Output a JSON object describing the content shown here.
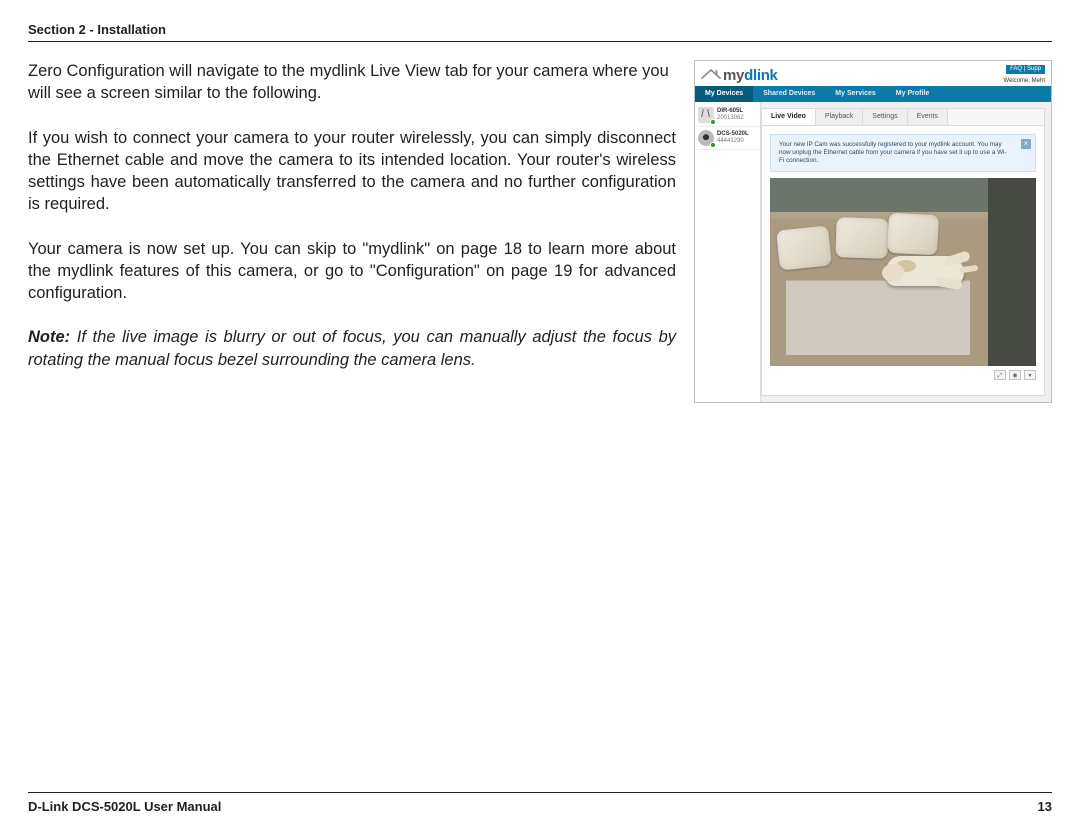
{
  "header": {
    "section_title": "Section 2 - Installation"
  },
  "body": {
    "p1": "Zero Configuration will navigate to the mydlink Live View tab for your camera where you will see a screen similar to the following.",
    "p2": "If you wish to connect your camera to your router wirelessly, you can simply disconnect the Ethernet cable and move the camera to its intended location. Your router's wireless settings have been automatically transferred to the camera and no further configuration is required.",
    "p3": "Your camera is now set up. You can skip to \"mydlink\" on page 18 to learn more about the mydlink features of this camera, or go to \"Configuration\" on page 19 for advanced configuration.",
    "note_label": "Note:",
    "note_text": " If the live image is blurry or out of focus, you can manually adjust the focus by rotating the manual focus bezel surrounding the camera lens."
  },
  "screenshot": {
    "brand_my": "my",
    "brand_dlink": "dlink",
    "faq": "FAQ | Supp",
    "welcome": "Welcome, Meht",
    "nav": [
      "My Devices",
      "Shared Devices",
      "My Services",
      "My Profile"
    ],
    "devices": [
      {
        "name": "DIR-605L",
        "id": "20013062"
      },
      {
        "name": "DCS-5020L",
        "id": "44441290"
      }
    ],
    "tabs": [
      "Live Video",
      "Playback",
      "Settings",
      "Events"
    ],
    "notice": "Your new IP Cam was successfully registered to your mydlink account. You may now unplug the Ethernet cable from your camera if you have set it up to use a Wi-Fi connection.",
    "close": "×"
  },
  "footer": {
    "manual": "D-Link DCS-5020L User Manual",
    "page": "13"
  }
}
